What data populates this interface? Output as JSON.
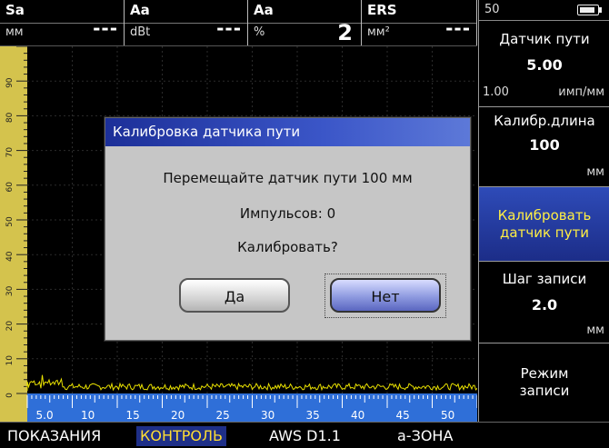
{
  "readings": [
    {
      "name": "Sa",
      "unit": "мм",
      "value": "---"
    },
    {
      "name": "Aa",
      "unit": "dBt",
      "value": "---"
    },
    {
      "name": "Aa",
      "unit": "%",
      "value": "2"
    },
    {
      "name": "ERS",
      "unit": "мм²",
      "value": "---"
    }
  ],
  "battery": {
    "level": "50"
  },
  "panel": {
    "encoder": {
      "title": "Датчик пути",
      "value": "5.00",
      "min": "1.00",
      "unit": "имп/мм"
    },
    "cal_length": {
      "title": "Калибр.длина",
      "value": "100",
      "unit": "мм"
    },
    "calibrate": {
      "title_line1": "Калибровать",
      "title_line2": "датчик пути"
    },
    "record_step": {
      "title": "Шаг записи",
      "value": "2.0",
      "unit": "мм"
    },
    "record_mode": {
      "title_line1": "Режим",
      "title_line2": "записи"
    }
  },
  "ruler": {
    "v_ticks": [
      "90",
      "80",
      "70",
      "60",
      "50",
      "40",
      "30",
      "20",
      "10",
      "0"
    ],
    "h_ticks": [
      "5.0",
      "10",
      "15",
      "20",
      "25",
      "30",
      "35",
      "40",
      "45",
      "50"
    ]
  },
  "dialog": {
    "title": "Калибровка датчика пути",
    "message": "Перемещайте датчик пути 100 мм",
    "pulses": "Импульсов: 0",
    "question": "Калибровать?",
    "yes": "Да",
    "no": "Нет"
  },
  "tabs": [
    {
      "label": "ПОКАЗАНИЯ",
      "active": false
    },
    {
      "label": "КОНТРОЛЬ",
      "active": true
    },
    {
      "label": "AWS D1.1",
      "active": false
    },
    {
      "label": "a-ЗОНА",
      "active": false
    }
  ],
  "colors": {
    "accent": "#1e2f88",
    "highlight": "#ffdd33",
    "signal": "#e8e000",
    "ruler": "#d4c34d"
  }
}
